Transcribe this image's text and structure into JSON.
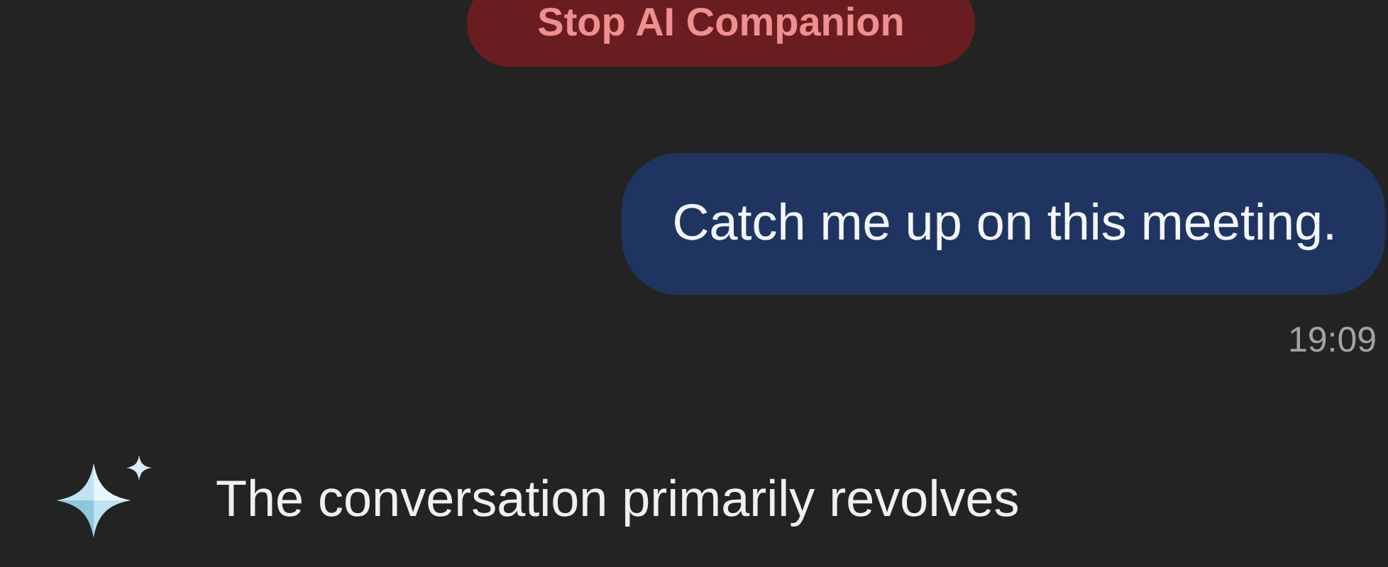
{
  "stop_button": {
    "label": "Stop AI Companion"
  },
  "messages": [
    {
      "kind": "user",
      "text": "Catch me up on this meeting.",
      "time": "19:09"
    },
    {
      "kind": "ai",
      "text": "The conversation primarily revolves"
    }
  ]
}
